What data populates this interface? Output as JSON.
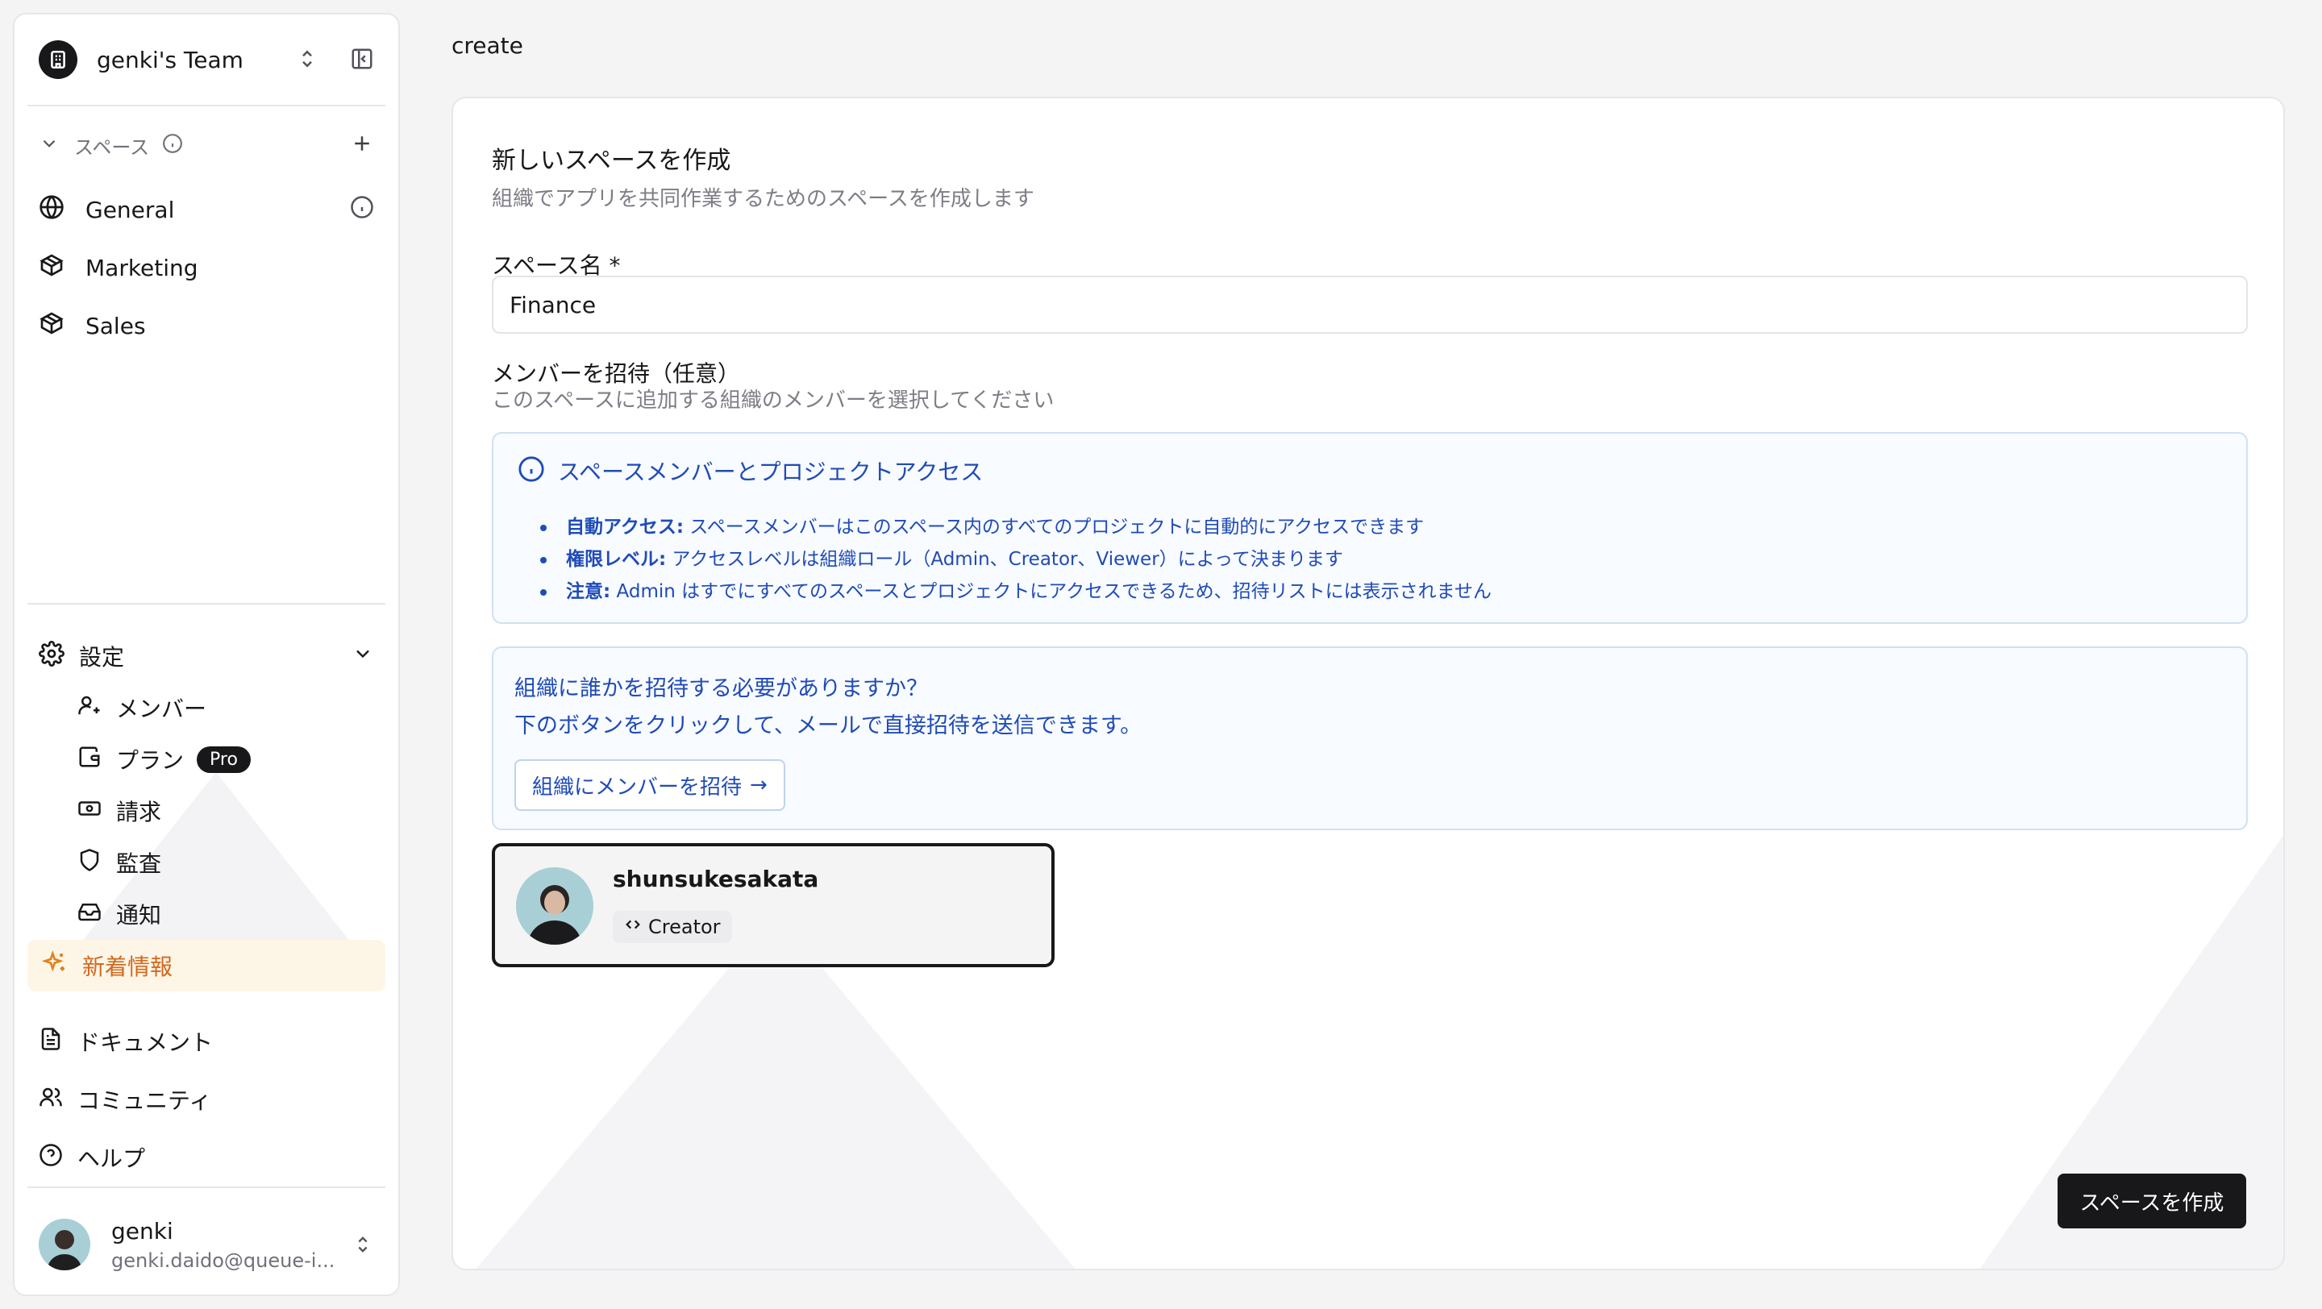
{
  "page_label": "create",
  "sidebar": {
    "team_name": "genki's Team",
    "spaces_section": {
      "label": "スペース"
    },
    "spaces": [
      {
        "label": "General",
        "icon": "globe-icon"
      },
      {
        "label": "Marketing",
        "icon": "box-icon"
      },
      {
        "label": "Sales",
        "icon": "box-icon"
      }
    ],
    "settings": {
      "label": "設定",
      "items": [
        {
          "label": "メンバー",
          "icon": "user-plus-icon"
        },
        {
          "label": "プラン",
          "icon": "wallet-icon",
          "badge": "Pro"
        },
        {
          "label": "請求",
          "icon": "banknote-icon"
        },
        {
          "label": "監査",
          "icon": "shield-icon"
        },
        {
          "label": "通知",
          "icon": "inbox-icon"
        }
      ]
    },
    "whats_new": "新着情報",
    "links": [
      {
        "label": "ドキュメント",
        "icon": "document-icon"
      },
      {
        "label": "コミュニティ",
        "icon": "users-icon"
      },
      {
        "label": "ヘルプ",
        "icon": "help-icon"
      }
    ],
    "user": {
      "name": "genki",
      "email": "genki.daido@queue-i..."
    }
  },
  "form": {
    "title": "新しいスペースを作成",
    "description": "組織でアプリを共同作業するためのスペースを作成します",
    "name_label": "スペース名 *",
    "name_value": "Finance",
    "invite_label": "メンバーを招待（任意）",
    "invite_description": "このスペースに追加する組織のメンバーを選択してください",
    "info": {
      "title": "スペースメンバーとプロジェクトアクセス",
      "items": [
        {
          "bold": "自動アクセス:",
          "text": " スペースメンバーはこのスペース内のすべてのプロジェクトに自動的にアクセスできます"
        },
        {
          "bold": "権限レベル:",
          "text": " アクセスレベルは組織ロール（Admin、Creator、Viewer）によって決まります"
        },
        {
          "bold": "注意:",
          "text": " Admin はすでにすべてのスペースとプロジェクトにアクセスできるため、招待リストには表示されません"
        }
      ]
    },
    "invite_box": {
      "line1": "組織に誰かを招待する必要がありますか？",
      "line2": "下のボタンをクリックして、メールで直接招待を送信できます。",
      "button": "組織にメンバーを招待",
      "button_arrow": "→"
    },
    "member": {
      "name": "shunsukesakata",
      "role": "Creator"
    },
    "submit": "スペースを作成"
  },
  "colors": {
    "accent_blue": "#1f4bb8",
    "whats_new_orange": "#d2691e",
    "dark": "#18181b"
  }
}
